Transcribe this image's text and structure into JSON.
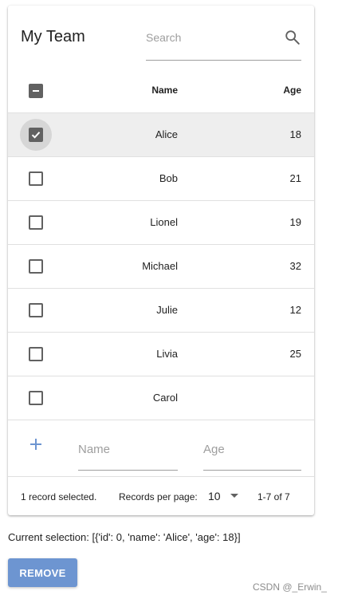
{
  "table": {
    "title": "My Team",
    "search_placeholder": "Search",
    "columns": {
      "name": "Name",
      "age": "Age"
    },
    "rows": [
      {
        "name": "Alice",
        "age": "18",
        "selected": true
      },
      {
        "name": "Bob",
        "age": "21",
        "selected": false
      },
      {
        "name": "Lionel",
        "age": "19",
        "selected": false
      },
      {
        "name": "Michael",
        "age": "32",
        "selected": false
      },
      {
        "name": "Julie",
        "age": "12",
        "selected": false
      },
      {
        "name": "Livia",
        "age": "25",
        "selected": false
      },
      {
        "name": "Carol",
        "age": "",
        "selected": false
      }
    ],
    "add_row": {
      "name_placeholder": "Name",
      "age_placeholder": "Age"
    },
    "footer": {
      "selected_text": "1 record selected.",
      "per_page_label": "Records per page:",
      "per_page_value": "10",
      "range_text": "1-7 of 7"
    }
  },
  "selection_text": "Current selection: [{'id': 0, 'name': 'Alice', 'age': 18}]",
  "remove_label": "REMOVE",
  "watermark": "CSDN @_Erwin_",
  "colors": {
    "accent": "#6d95d1",
    "checkbox": "#616161",
    "selected_row": "#eeeeee"
  }
}
